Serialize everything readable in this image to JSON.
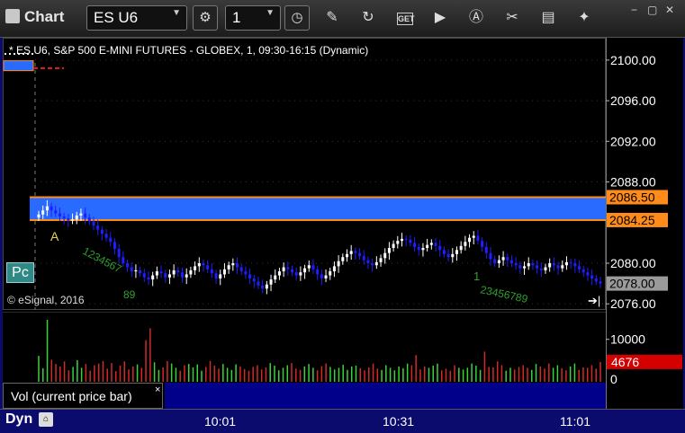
{
  "toolbar": {
    "app_title": "Chart",
    "symbol": "ES U6",
    "interval": "1",
    "icons": [
      "gear-icon",
      "clock-icon",
      "pencil-icon",
      "refresh-icon",
      "get-icon",
      "play-icon",
      "a-icon",
      "tools-icon",
      "chat-icon",
      "twitter-icon"
    ],
    "get_label": "GET"
  },
  "chart": {
    "header": "* ES U6, S&P 500 E-MINI FUTURES - GLOBEX, 1, 09:30-16:15 (Dynamic)",
    "copyright": "© eSignal, 2016",
    "pc_badge": "Pc",
    "marker_a": "A",
    "annotation_green_1": "1234567",
    "annotation_green_2": "89",
    "annotation_green_3": "1",
    "annotation_green_4": "23456789",
    "colors": {
      "up": "#ffffff",
      "down": "#1e1eff",
      "band": "#2a6bff",
      "band_edge": "#ff8c1a",
      "current": "#9a9a9a",
      "volume_up": "#3cd13c",
      "volume_down": "#d12a2a"
    }
  },
  "chart_data": {
    "type": "candlestick",
    "price_ticks": [
      "2100.00",
      "2096.00",
      "2092.00",
      "2088.00",
      "2080.00",
      "2076.00"
    ],
    "price_tick_values": [
      2100,
      2096,
      2092,
      2088,
      2080,
      2076
    ],
    "ylim": [
      2075.4,
      2102.2
    ],
    "price_labels": {
      "band_top": "2086.50",
      "band_bottom": "2084.25",
      "current": "2078.00"
    },
    "band": [
      2084.25,
      2086.5
    ],
    "time_labels": [
      "10:01",
      "10:31",
      "11:01"
    ],
    "prices_close": [
      2084.8,
      2085.2,
      2085.6,
      2085.2,
      2084.9,
      2084.6,
      2084.4,
      2084.2,
      2084.3,
      2084.7,
      2084.9,
      2084.5,
      2084.1,
      2083.7,
      2083.3,
      2082.9,
      2082.5,
      2082.1,
      2081.4,
      2080.6,
      2080.0,
      2079.6,
      2079.2,
      2079.3,
      2079.0,
      2078.6,
      2078.4,
      2078.8,
      2079.2,
      2079.0,
      2078.6,
      2078.9,
      2079.3,
      2079.1,
      2078.6,
      2078.9,
      2079.3,
      2079.7,
      2080.0,
      2079.8,
      2079.4,
      2079.0,
      2078.5,
      2078.9,
      2079.4,
      2079.8,
      2080.0,
      2079.6,
      2079.2,
      2078.9,
      2078.5,
      2078.2,
      2077.8,
      2077.5,
      2077.9,
      2078.4,
      2078.8,
      2079.2,
      2079.6,
      2079.4,
      2079.1,
      2078.8,
      2079.1,
      2079.5,
      2079.8,
      2079.4,
      2078.9,
      2078.5,
      2078.8,
      2079.2,
      2079.7,
      2080.2,
      2080.6,
      2080.9,
      2081.2,
      2081.0,
      2080.7,
      2080.3,
      2080.0,
      2079.8,
      2080.1,
      2080.5,
      2081.0,
      2081.5,
      2081.9,
      2082.2,
      2082.4,
      2082.3,
      2082.0,
      2081.6,
      2081.3,
      2081.5,
      2081.8,
      2082.0,
      2081.7,
      2081.3,
      2080.9,
      2080.6,
      2080.9,
      2081.3,
      2081.7,
      2082.1,
      2082.5,
      2082.7,
      2082.2,
      2081.6,
      2081.0,
      2080.4,
      2080.0,
      2080.3,
      2080.6,
      2080.3,
      2080.0,
      2079.8,
      2079.5,
      2079.7,
      2080.0,
      2079.8,
      2079.5,
      2079.3,
      2079.6,
      2080.0,
      2079.8,
      2079.5,
      2079.8,
      2080.1,
      2080.0,
      2079.7,
      2079.4,
      2079.1,
      2078.8,
      2078.5,
      2078.2,
      2078.0
    ],
    "volume_ticks": [
      "10000",
      "0"
    ],
    "volume_current": "4676",
    "volume_ylim": [
      0,
      16500
    ],
    "volume_values": [
      6100,
      3200,
      14600,
      5200,
      4200,
      3600,
      4800,
      2700,
      3500,
      5100,
      3300,
      4200,
      2600,
      3900,
      4300,
      4900,
      3100,
      4400,
      2500,
      3800,
      4800,
      2900,
      3600,
      4100,
      3300,
      9800,
      12600,
      4600,
      2800,
      3400,
      4900,
      4300,
      3300,
      2600,
      3900,
      4200,
      3400,
      4100,
      2600,
      3500,
      4900,
      3800,
      3100,
      4200,
      3300,
      2800,
      4100,
      3600,
      3000,
      2600,
      3500,
      3900,
      2900,
      3400,
      4400,
      3800,
      2700,
      3300,
      3900,
      4400,
      3100,
      2800,
      3600,
      4200,
      3300,
      2700,
      3700,
      4300,
      3500,
      2900,
      3300,
      4000,
      2800,
      3600,
      3800,
      3200,
      2700,
      3400,
      4300,
      3100,
      2800,
      3900,
      3300,
      2700,
      3600,
      3200,
      4300,
      3900,
      6300,
      2900,
      3600,
      3300,
      3800,
      4300,
      2700,
      3100,
      2600,
      3900,
      3300,
      2900,
      3300,
      4300,
      3800,
      2800,
      7100,
      3500,
      3400,
      4800,
      3900,
      2600,
      3300,
      2900,
      3500,
      3900,
      3300,
      2800,
      4200,
      3600,
      3100,
      4300,
      3300,
      3900,
      3200,
      2700,
      3600,
      4300,
      2800,
      3400,
      3300,
      3900,
      3100,
      4676
    ]
  },
  "volume_panel": {
    "legend": "Vol (current price bar)",
    "close": "×"
  },
  "status": {
    "mode": "Dyn"
  }
}
